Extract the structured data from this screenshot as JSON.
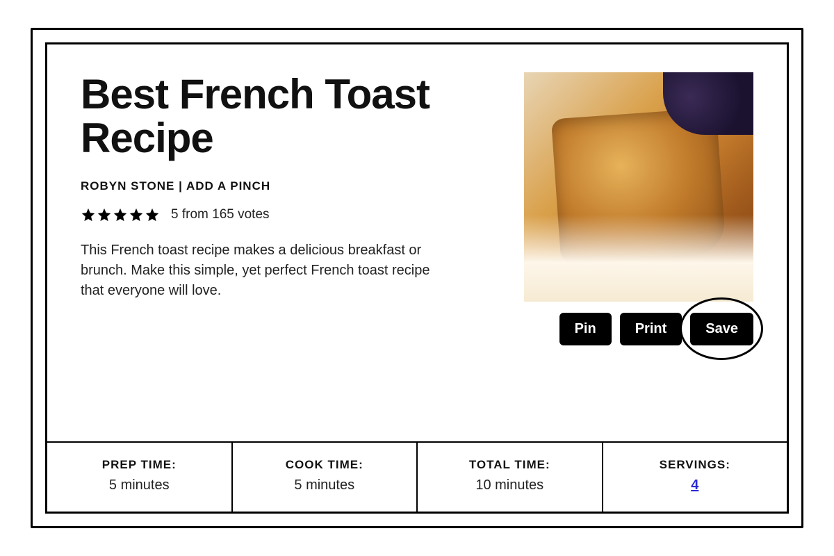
{
  "recipe": {
    "title": "Best French Toast Recipe",
    "author": "ROBYN STONE | ADD A PINCH",
    "rating_score": "5",
    "rating_votes_text": "5 from 165 votes",
    "description": "This French toast recipe makes a delicious breakfast or brunch. Make this simple, yet perfect French toast recipe that everyone will love."
  },
  "actions": {
    "pin": "Pin",
    "print": "Print",
    "save": "Save"
  },
  "meta": {
    "prep": {
      "label": "PREP TIME:",
      "value": "5 minutes"
    },
    "cook": {
      "label": "COOK TIME:",
      "value": "5 minutes"
    },
    "total": {
      "label": "TOTAL TIME:",
      "value": "10 minutes"
    },
    "servings": {
      "label": "SERVINGS:",
      "value": "4"
    }
  }
}
